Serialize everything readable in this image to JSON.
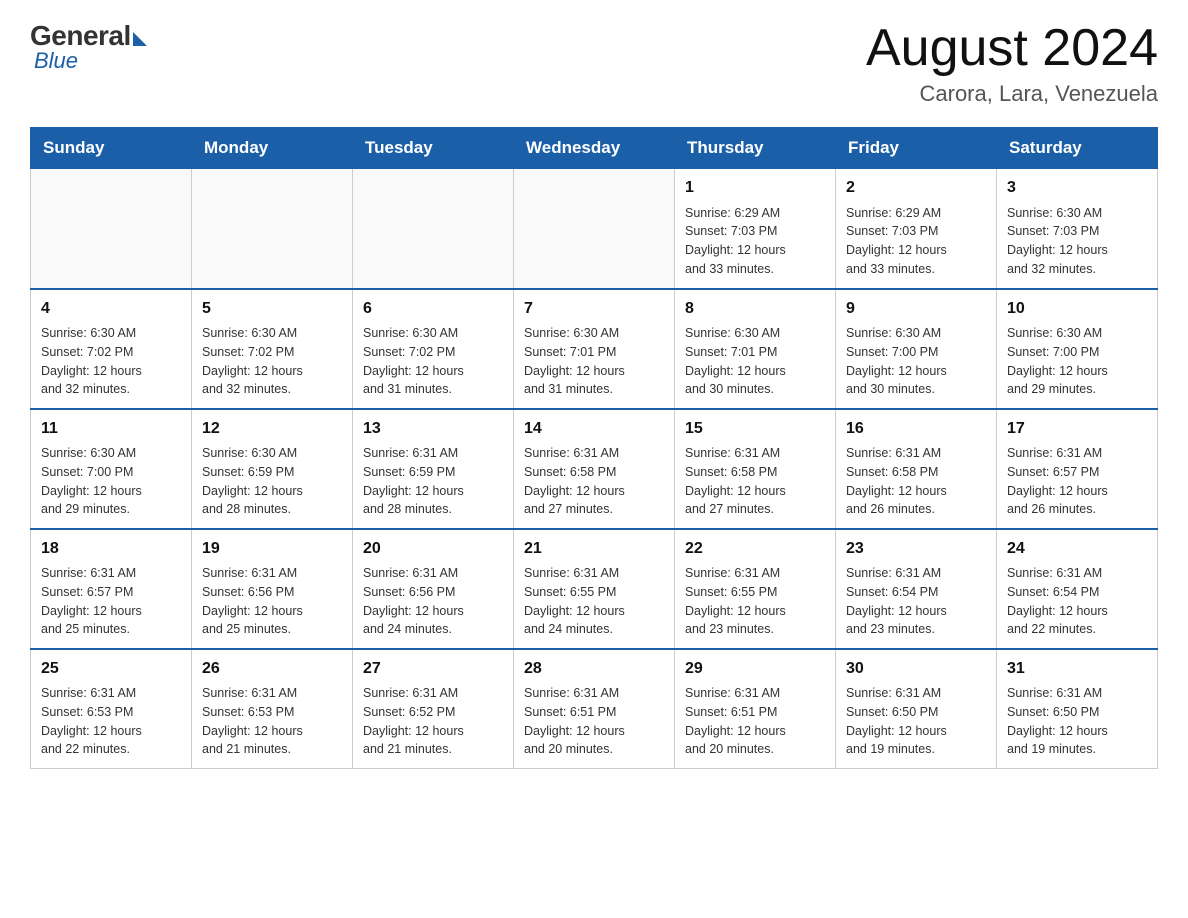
{
  "logo": {
    "general": "General",
    "blue": "Blue",
    "tagline": "Blue"
  },
  "header": {
    "month_title": "August 2024",
    "location": "Carora, Lara, Venezuela"
  },
  "weekdays": [
    "Sunday",
    "Monday",
    "Tuesday",
    "Wednesday",
    "Thursday",
    "Friday",
    "Saturday"
  ],
  "weeks": [
    [
      {
        "day": "",
        "info": ""
      },
      {
        "day": "",
        "info": ""
      },
      {
        "day": "",
        "info": ""
      },
      {
        "day": "",
        "info": ""
      },
      {
        "day": "1",
        "info": "Sunrise: 6:29 AM\nSunset: 7:03 PM\nDaylight: 12 hours\nand 33 minutes."
      },
      {
        "day": "2",
        "info": "Sunrise: 6:29 AM\nSunset: 7:03 PM\nDaylight: 12 hours\nand 33 minutes."
      },
      {
        "day": "3",
        "info": "Sunrise: 6:30 AM\nSunset: 7:03 PM\nDaylight: 12 hours\nand 32 minutes."
      }
    ],
    [
      {
        "day": "4",
        "info": "Sunrise: 6:30 AM\nSunset: 7:02 PM\nDaylight: 12 hours\nand 32 minutes."
      },
      {
        "day": "5",
        "info": "Sunrise: 6:30 AM\nSunset: 7:02 PM\nDaylight: 12 hours\nand 32 minutes."
      },
      {
        "day": "6",
        "info": "Sunrise: 6:30 AM\nSunset: 7:02 PM\nDaylight: 12 hours\nand 31 minutes."
      },
      {
        "day": "7",
        "info": "Sunrise: 6:30 AM\nSunset: 7:01 PM\nDaylight: 12 hours\nand 31 minutes."
      },
      {
        "day": "8",
        "info": "Sunrise: 6:30 AM\nSunset: 7:01 PM\nDaylight: 12 hours\nand 30 minutes."
      },
      {
        "day": "9",
        "info": "Sunrise: 6:30 AM\nSunset: 7:00 PM\nDaylight: 12 hours\nand 30 minutes."
      },
      {
        "day": "10",
        "info": "Sunrise: 6:30 AM\nSunset: 7:00 PM\nDaylight: 12 hours\nand 29 minutes."
      }
    ],
    [
      {
        "day": "11",
        "info": "Sunrise: 6:30 AM\nSunset: 7:00 PM\nDaylight: 12 hours\nand 29 minutes."
      },
      {
        "day": "12",
        "info": "Sunrise: 6:30 AM\nSunset: 6:59 PM\nDaylight: 12 hours\nand 28 minutes."
      },
      {
        "day": "13",
        "info": "Sunrise: 6:31 AM\nSunset: 6:59 PM\nDaylight: 12 hours\nand 28 minutes."
      },
      {
        "day": "14",
        "info": "Sunrise: 6:31 AM\nSunset: 6:58 PM\nDaylight: 12 hours\nand 27 minutes."
      },
      {
        "day": "15",
        "info": "Sunrise: 6:31 AM\nSunset: 6:58 PM\nDaylight: 12 hours\nand 27 minutes."
      },
      {
        "day": "16",
        "info": "Sunrise: 6:31 AM\nSunset: 6:58 PM\nDaylight: 12 hours\nand 26 minutes."
      },
      {
        "day": "17",
        "info": "Sunrise: 6:31 AM\nSunset: 6:57 PM\nDaylight: 12 hours\nand 26 minutes."
      }
    ],
    [
      {
        "day": "18",
        "info": "Sunrise: 6:31 AM\nSunset: 6:57 PM\nDaylight: 12 hours\nand 25 minutes."
      },
      {
        "day": "19",
        "info": "Sunrise: 6:31 AM\nSunset: 6:56 PM\nDaylight: 12 hours\nand 25 minutes."
      },
      {
        "day": "20",
        "info": "Sunrise: 6:31 AM\nSunset: 6:56 PM\nDaylight: 12 hours\nand 24 minutes."
      },
      {
        "day": "21",
        "info": "Sunrise: 6:31 AM\nSunset: 6:55 PM\nDaylight: 12 hours\nand 24 minutes."
      },
      {
        "day": "22",
        "info": "Sunrise: 6:31 AM\nSunset: 6:55 PM\nDaylight: 12 hours\nand 23 minutes."
      },
      {
        "day": "23",
        "info": "Sunrise: 6:31 AM\nSunset: 6:54 PM\nDaylight: 12 hours\nand 23 minutes."
      },
      {
        "day": "24",
        "info": "Sunrise: 6:31 AM\nSunset: 6:54 PM\nDaylight: 12 hours\nand 22 minutes."
      }
    ],
    [
      {
        "day": "25",
        "info": "Sunrise: 6:31 AM\nSunset: 6:53 PM\nDaylight: 12 hours\nand 22 minutes."
      },
      {
        "day": "26",
        "info": "Sunrise: 6:31 AM\nSunset: 6:53 PM\nDaylight: 12 hours\nand 21 minutes."
      },
      {
        "day": "27",
        "info": "Sunrise: 6:31 AM\nSunset: 6:52 PM\nDaylight: 12 hours\nand 21 minutes."
      },
      {
        "day": "28",
        "info": "Sunrise: 6:31 AM\nSunset: 6:51 PM\nDaylight: 12 hours\nand 20 minutes."
      },
      {
        "day": "29",
        "info": "Sunrise: 6:31 AM\nSunset: 6:51 PM\nDaylight: 12 hours\nand 20 minutes."
      },
      {
        "day": "30",
        "info": "Sunrise: 6:31 AM\nSunset: 6:50 PM\nDaylight: 12 hours\nand 19 minutes."
      },
      {
        "day": "31",
        "info": "Sunrise: 6:31 AM\nSunset: 6:50 PM\nDaylight: 12 hours\nand 19 minutes."
      }
    ]
  ]
}
